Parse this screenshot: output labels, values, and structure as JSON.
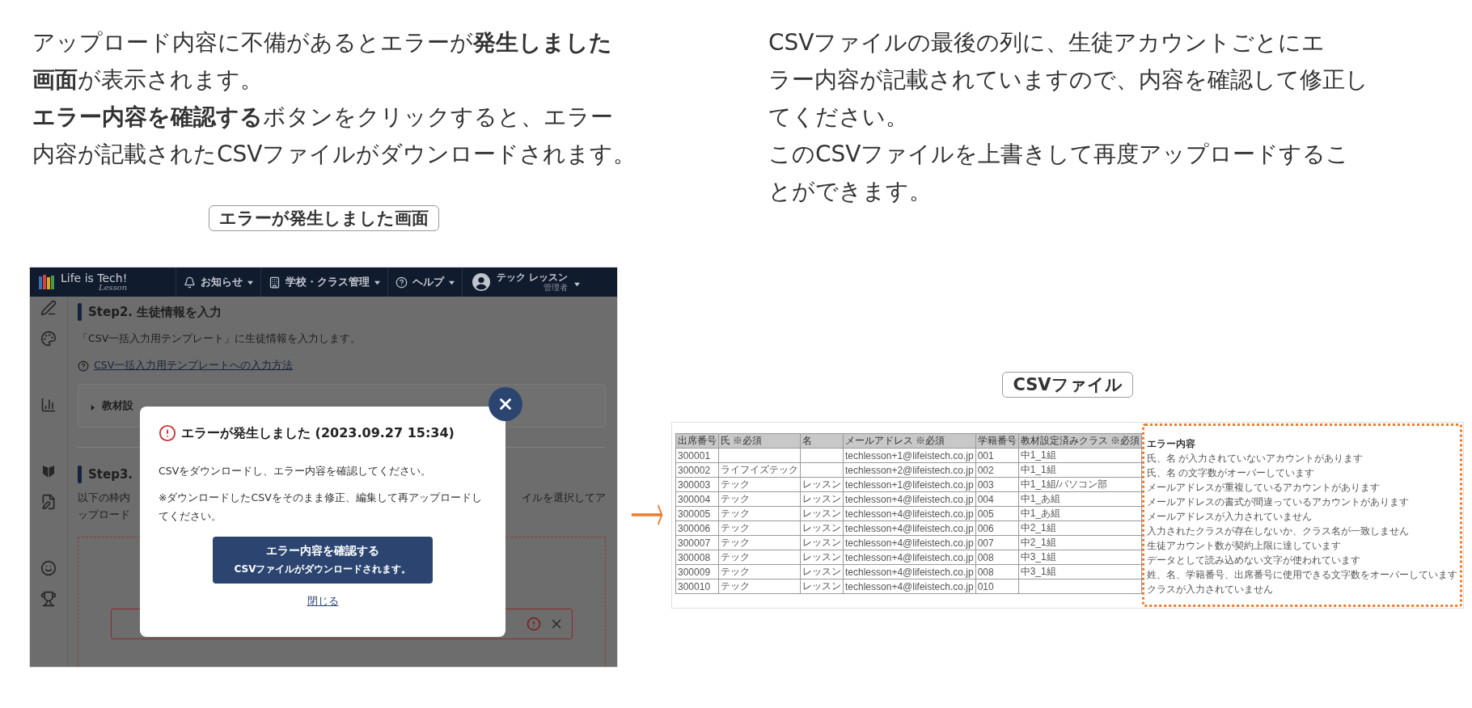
{
  "intro": {
    "lines": [
      "アップロード内容に不備があるとエラーが**発生しました**",
      "**画面**が表示されます。",
      "**エラー内容を確認する**ボタンをクリックすると、エラー",
      "内容が記載されたCSVファイルがダウンロードされます。"
    ],
    "caption": "エラーが発生しました画面"
  },
  "app_screenshot": {
    "header": {
      "logo": "Life is Tech!",
      "logo_sub": "Lesson",
      "menus": [
        {
          "label": "お知らせ"
        },
        {
          "label": "学校・クラス管理"
        },
        {
          "label": "ヘルプ"
        }
      ],
      "user": {
        "name": "テック レッスン",
        "role": "管理者"
      }
    },
    "step2": {
      "title": "Step2. 生徒情報を入力",
      "text": "「CSV一括入力用テンプレート」に生徒情報を入力します。",
      "link": "CSV一括入力用テンプレートへの入力方法",
      "accordion": {
        "label": "教材設",
        "expanded": false
      }
    },
    "step3": {
      "title": "Step3.",
      "text_left": "以下の枠内",
      "text_right": "イルを選択してア",
      "text_line2": "ップロード"
    },
    "modal": {
      "title": "エラーが発生しました (2023.09.27 15:34)",
      "message": "CSVをダウンロードし、エラー内容を確認してください。",
      "note": "※ダウンロードしたCSVをそのまま修正、編集して再アップロードしてください。",
      "button": {
        "label": "エラー内容を確認する",
        "sub": "CSVファイルがダウンロードされます。"
      },
      "close_link": "閉じる"
    }
  },
  "csv": {
    "lines": [
      "CSVファイルの最後の列に、生徒アカウントごとにエ",
      "ラー内容が記載されていますので、内容を確認して修正し",
      "てください。",
      "このCSVファイルを上書きして再度アップロードするこ",
      "とができます。"
    ],
    "caption": "CSVファイル",
    "table": {
      "columns": [
        "出席番号",
        "氏 ※必須",
        "名",
        "メールアドレス ※必須",
        "学籍番号",
        "教材設定済みクラス ※必須"
      ],
      "rows": [
        [
          "300001",
          "",
          "",
          "techlesson+1@lifeistech.co.jp",
          "001",
          "中1_1組"
        ],
        [
          "300002",
          "ライフイズテック",
          "",
          "techlesson+2@lifeistech.co.jp",
          "002",
          "中1_1組"
        ],
        [
          "300003",
          "テック",
          "レッスン",
          "techlesson+1@lifeistech.co.jp",
          "003",
          "中1_1組/パソコン部"
        ],
        [
          "300004",
          "テック",
          "レッスン",
          "techlesson+4@lifeistech.co.jp",
          "004",
          "中1_あ組"
        ],
        [
          "300005",
          "テック",
          "レッスン",
          "techlesson+4@lifeistech.co.jp",
          "005",
          "中1_あ組"
        ],
        [
          "300006",
          "テック",
          "レッスン",
          "techlesson+4@lifeistech.co.jp",
          "006",
          "中2_1組"
        ],
        [
          "300007",
          "テック",
          "レッスン",
          "techlesson+4@lifeistech.co.jp",
          "007",
          "中2_1組"
        ],
        [
          "300008",
          "テック",
          "レッスン",
          "techlesson+4@lifeistech.co.jp",
          "008",
          "中3_1組"
        ],
        [
          "300009",
          "テック",
          "レッスン",
          "techlesson+4@lifeistech.co.jp",
          "008",
          "中3_1組"
        ],
        [
          "300010",
          "テック",
          "レッスン",
          "techlesson+4@lifeistech.co.jp",
          "010",
          ""
        ]
      ]
    },
    "errors": {
      "title": "エラー内容",
      "items": [
        "氏、名 が入力されていないアカウントがあります",
        "氏、名 の文字数がオーバーしています",
        "メールアドレスが重複しているアカウントがあります",
        "メールアドレスの書式が間違っているアカウントがあります",
        "メールアドレスが入力されていません",
        "入力されたクラスが存在しないか、クラス名が一致しません",
        "生徒アカウント数が契約上限に達しています",
        "データとして読み込めない文字が使われています",
        "姓、名、学籍番号、出席番号に使用できる文字数をオーバーしています",
        "クラスが入力されていません"
      ]
    }
  }
}
